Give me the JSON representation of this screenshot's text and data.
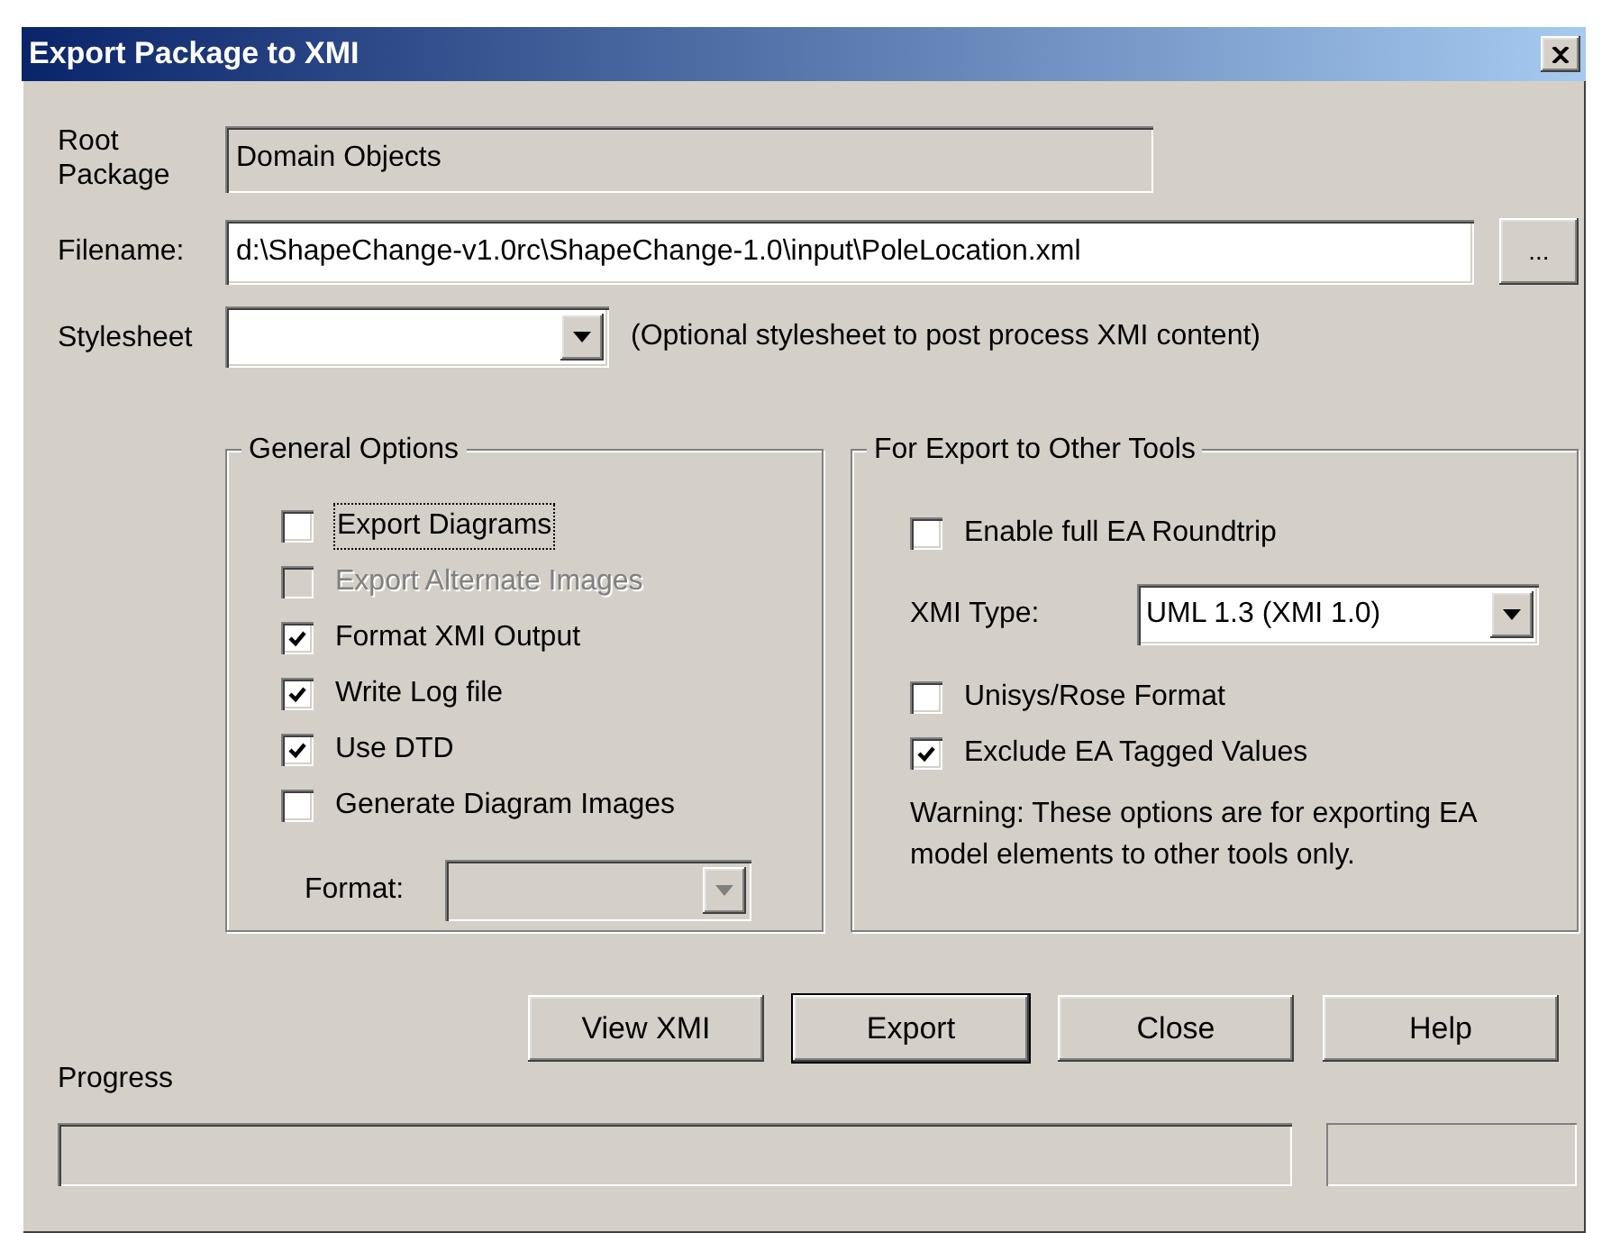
{
  "window": {
    "title": "Export Package to XMI"
  },
  "root_package": {
    "label": "Root Package",
    "value": "Domain Objects"
  },
  "filename": {
    "label": "Filename:",
    "value": "d:\\ShapeChange-v1.0rc\\ShapeChange-1.0\\input\\PoleLocation.xml",
    "browse_button": "..."
  },
  "stylesheet": {
    "label": "Stylesheet",
    "note": "(Optional stylesheet to post process XMI content)"
  },
  "general_options": {
    "title": "General Options",
    "items": [
      {
        "kind": "checkbox",
        "label": "Export Diagrams",
        "checked": false,
        "disabled": false,
        "focused": true
      },
      {
        "kind": "checkbox",
        "label": "Export Alternate Images",
        "checked": false,
        "disabled": true,
        "focused": false
      },
      {
        "kind": "checkbox",
        "label": "Format XMI Output",
        "checked": true,
        "disabled": false,
        "focused": false
      },
      {
        "kind": "checkbox",
        "label": "Write Log file",
        "checked": true,
        "disabled": false,
        "focused": false
      },
      {
        "kind": "checkbox",
        "label": "Use DTD",
        "checked": true,
        "disabled": false,
        "focused": false
      },
      {
        "kind": "checkbox",
        "label": "Generate Diagram Images",
        "checked": false,
        "disabled": false,
        "focused": false
      },
      {
        "kind": "select",
        "label": "Format:",
        "disabled": true
      }
    ]
  },
  "export_tools": {
    "title": "For Export to Other Tools",
    "items": [
      {
        "kind": "checkbox",
        "label": "Enable full EA Roundtrip",
        "checked": false,
        "disabled": false,
        "focused": false
      },
      {
        "kind": "select",
        "label": "XMI Type:",
        "value": "UML 1.3 (XMI 1.0)",
        "disabled": false
      },
      {
        "kind": "checkbox",
        "label": "Unisys/Rose Format",
        "checked": false,
        "disabled": false,
        "focused": false
      },
      {
        "kind": "checkbox",
        "label": "Exclude EA Tagged Values",
        "checked": true,
        "disabled": false,
        "focused": false
      },
      {
        "kind": "note",
        "label": "Warning: These options are for exporting EA model elements to other tools only."
      }
    ]
  },
  "buttons": [
    {
      "label": "View XMI",
      "default": false
    },
    {
      "label": "Export",
      "default": true
    },
    {
      "label": "Close",
      "default": false
    },
    {
      "label": "Help",
      "default": false
    }
  ],
  "progress": {
    "label": "Progress",
    "level": 0
  }
}
